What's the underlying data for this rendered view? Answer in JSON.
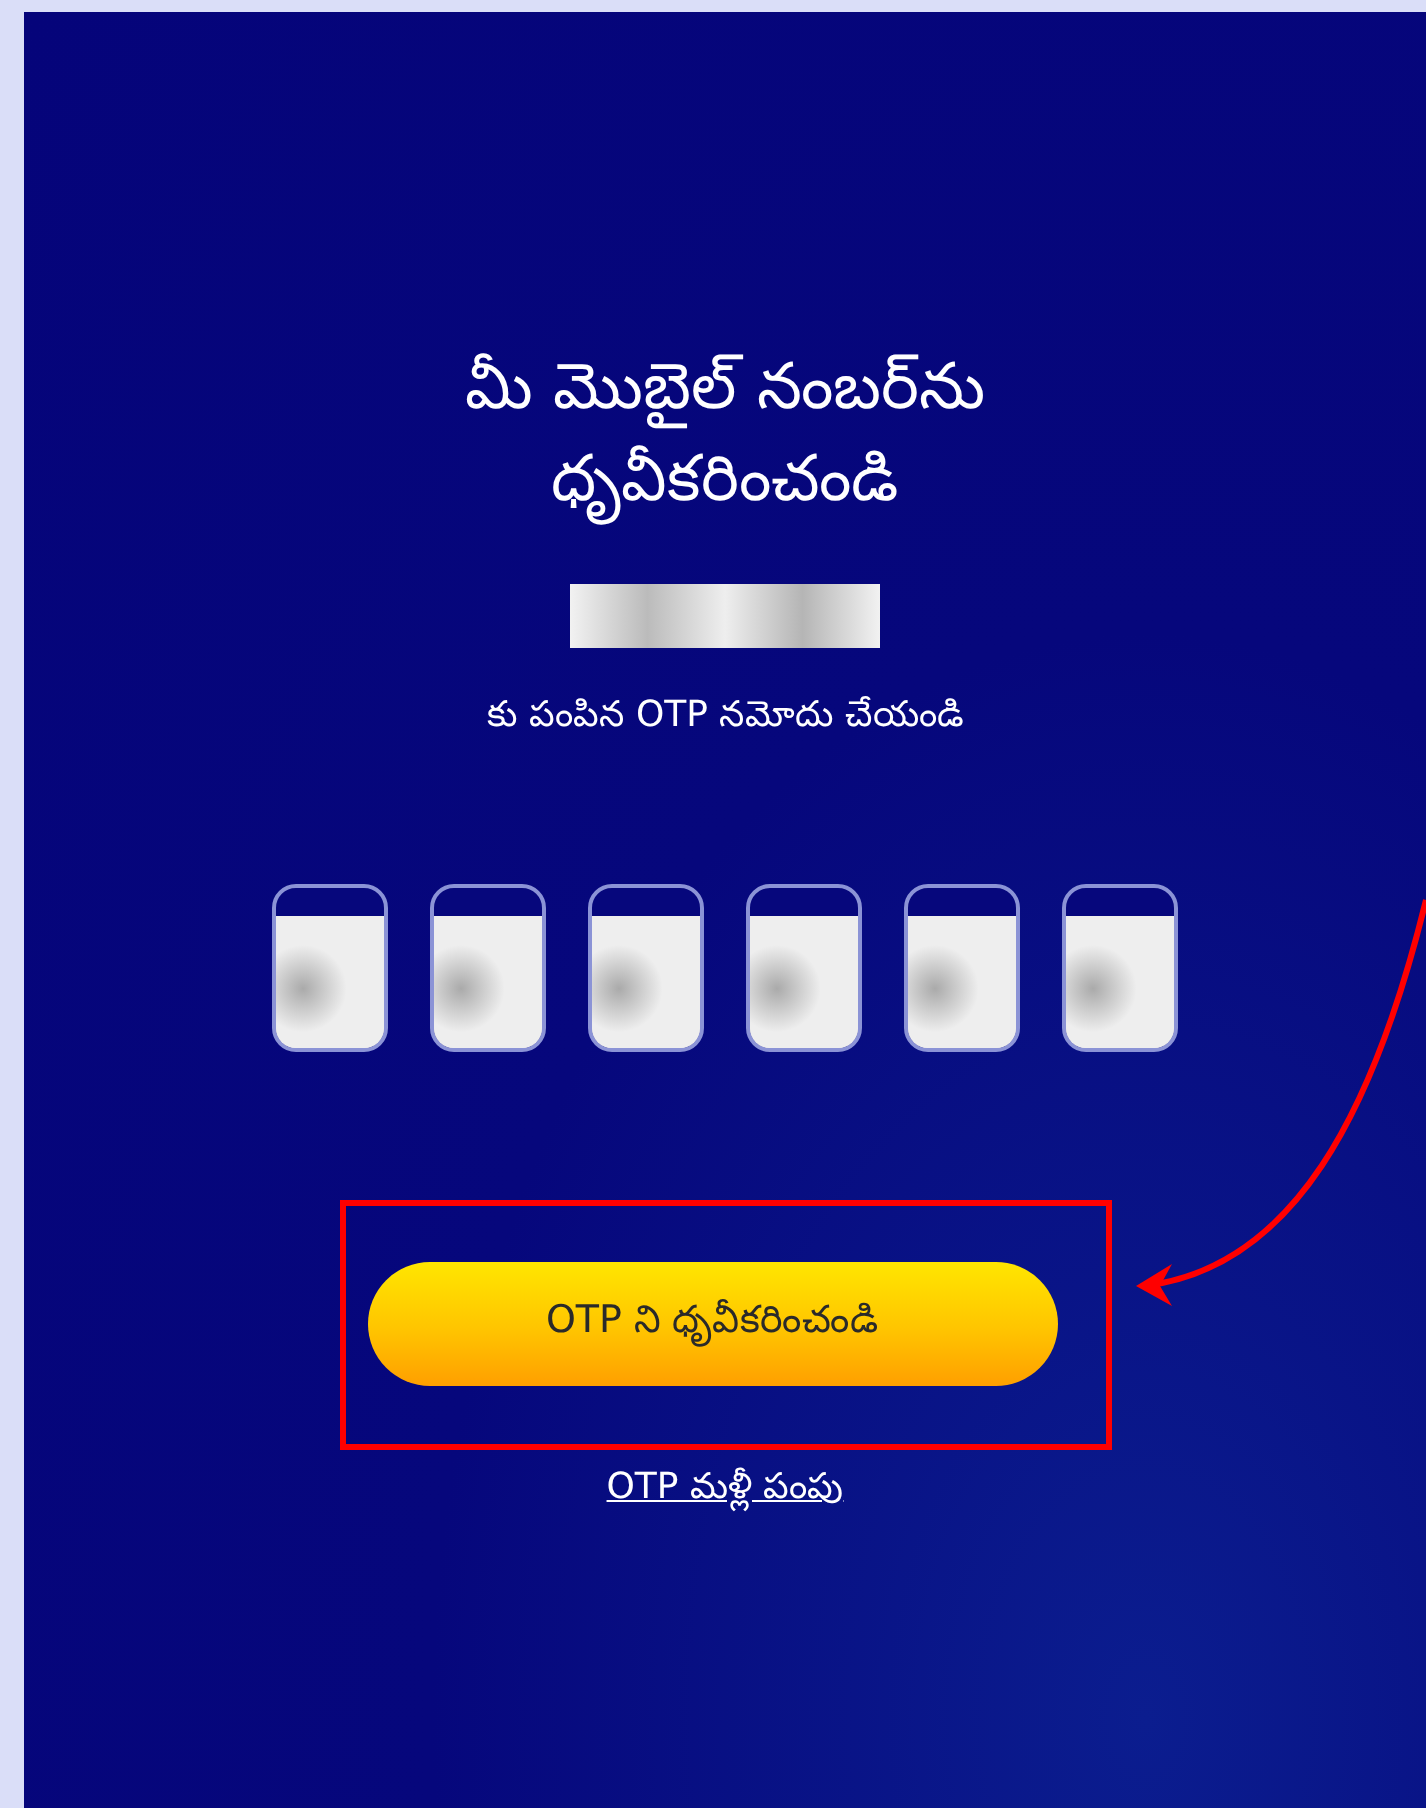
{
  "title": "మీ మొబైల్ నంబర్‌ను ధృవీకరించండి",
  "phone_number": {
    "redacted": true
  },
  "subtitle": "కు పంపిన OTP నమోదు చేయండి",
  "otp_boxes": [
    {
      "redacted": true
    },
    {
      "redacted": true
    },
    {
      "redacted": true
    },
    {
      "redacted": true
    },
    {
      "redacted": true
    },
    {
      "redacted": true
    }
  ],
  "verify_button": {
    "label": "OTP ని ధృవీకరించండి",
    "highlighted": true
  },
  "resend_link": "OTP మళ్లీ పంపు"
}
